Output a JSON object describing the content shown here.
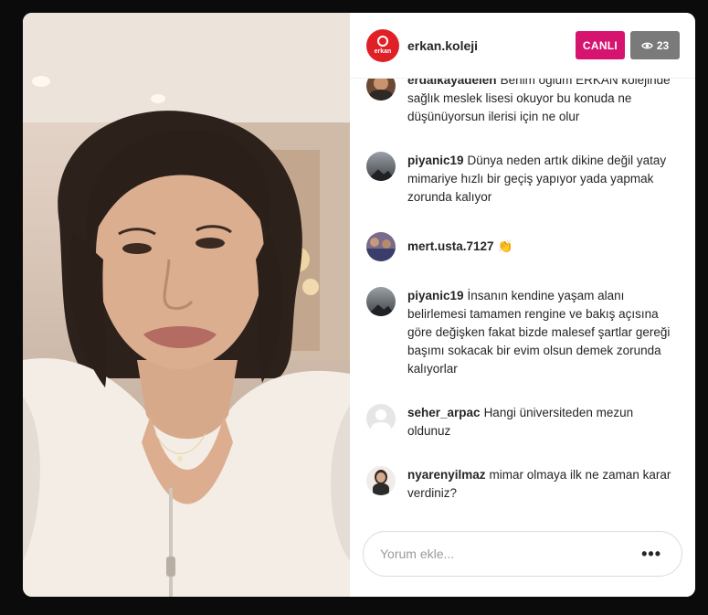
{
  "header": {
    "username": "erkan.koleji",
    "live_label": "CANLI",
    "viewer_count": "23",
    "avatar_brand_text": "erkan"
  },
  "comments": [
    {
      "user": "erdalkayadelen",
      "text": "Benim oğlum ERKAN kolejinde sağlık meslek lisesi okuyor bu konuda ne düşünüyorsun ilerisi için ne olur"
    },
    {
      "user": "piyanic19",
      "text": "Dünya neden artık dikine değil yatay mimariye hızlı bir geçiş yapıyor yada yapmak zorunda kalıyor"
    },
    {
      "user": "mert.usta.7127",
      "text": "👏"
    },
    {
      "user": "piyanic19",
      "text": "İnsanın kendine yaşam alanı belirlemesi tamamen rengine ve bakış açısına göre değişken fakat bizde malesef şartlar gereği başımı sokacak bir evim olsun demek zorunda kalıyorlar"
    },
    {
      "user": "seher_arpac",
      "text": "Hangi üniversiteden mezun oldunuz"
    },
    {
      "user": "nyarenyilmaz",
      "text": "mimar olmaya ilk ne zaman karar verdiniz?"
    }
  ],
  "footer": {
    "placeholder": "Yorum ekle...",
    "more_label": "•••"
  },
  "colors": {
    "live_badge": "#d6136f",
    "viewer_badge": "#7a7a7a",
    "brand": "#e02027"
  },
  "icons": {
    "viewer": "eye-icon",
    "more": "more-options-icon"
  }
}
